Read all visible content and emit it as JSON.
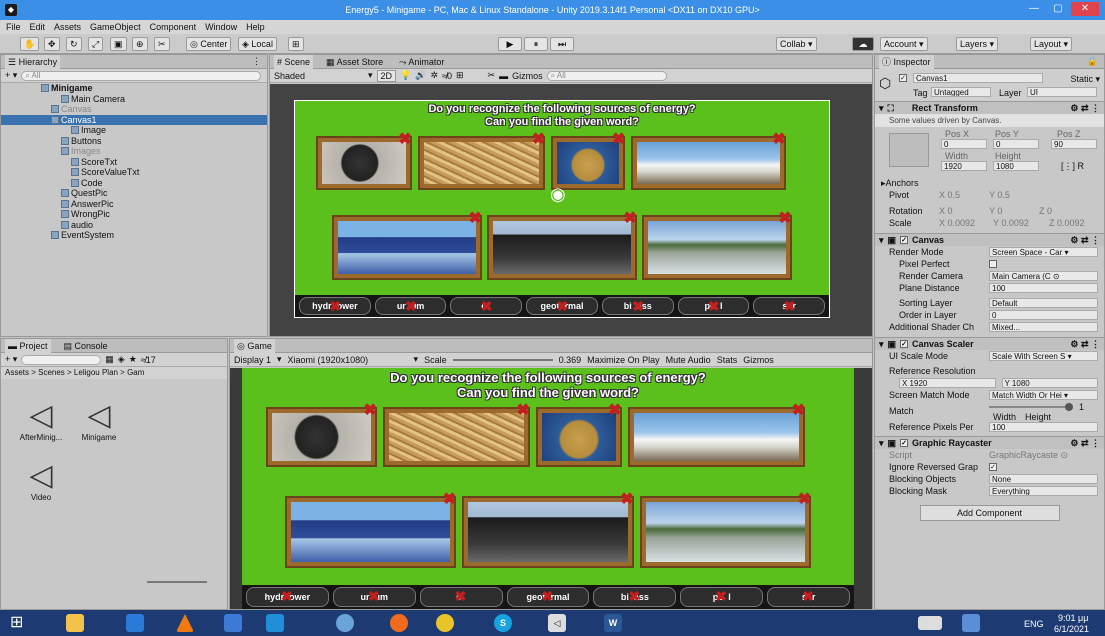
{
  "window": {
    "title": "Energy5 - Minigame - PC, Mac & Linux Standalone - Unity 2019.3.14f1 Personal <DX11 on DX10 GPU>",
    "app_icon": "unity-icon"
  },
  "menu": [
    "File",
    "Edit",
    "Assets",
    "GameObject",
    "Component",
    "Window",
    "Help"
  ],
  "toolbar": {
    "tools": [
      "hand-tool-icon",
      "move-tool-icon",
      "rotate-tool-icon",
      "scale-tool-icon",
      "rect-tool-icon",
      "transform-tool-icon",
      "custom-tool-icon"
    ],
    "center": "Center",
    "local": "Local",
    "play": "▶",
    "pause": "⏸",
    "step": "⏭",
    "collab": "Collab ▾",
    "account": "Account",
    "layers": "Layers",
    "layout": "Layout"
  },
  "hierarchy": {
    "tab": "Hierarchy",
    "search": "All",
    "items": [
      {
        "label": "Minigame",
        "indent": 0,
        "bold": true
      },
      {
        "label": "Main Camera",
        "indent": 2
      },
      {
        "label": "Canvas",
        "indent": 1,
        "dim": true
      },
      {
        "label": "Canvas1",
        "indent": 1,
        "selected": true
      },
      {
        "label": "Image",
        "indent": 3
      },
      {
        "label": "Buttons",
        "indent": 2
      },
      {
        "label": "Images",
        "indent": 2,
        "dim": true
      },
      {
        "label": "ScoreTxt",
        "indent": 3
      },
      {
        "label": "ScoreValueTxt",
        "indent": 3
      },
      {
        "label": "Code",
        "indent": 3
      },
      {
        "label": "QuestPic",
        "indent": 2
      },
      {
        "label": "AnswerPic",
        "indent": 2
      },
      {
        "label": "WrongPic",
        "indent": 2
      },
      {
        "label": "audio",
        "indent": 2
      },
      {
        "label": "EventSystem",
        "indent": 1
      }
    ]
  },
  "scene": {
    "tabs": [
      "Scene",
      "Asset Store",
      "Animator"
    ],
    "shading": "Shaded",
    "mode2d": "2D",
    "fx": "≉0",
    "gizmos": "Gizmos",
    "search": "All"
  },
  "game_canvas": {
    "question_line1": "Do you recognize the following sources of energy?",
    "question_line2": "Can you find the given word?",
    "top_pictures": [
      "rock",
      "straw",
      "urock",
      "geyser"
    ],
    "bottom_pictures": [
      "solar",
      "barrel",
      "dam"
    ],
    "words": [
      "hydr  ower",
      "ur  um",
      "c  ",
      "geot  rmal",
      "bi  ass",
      "pe  l",
      "s  r"
    ]
  },
  "project": {
    "tabs": [
      "Project",
      "Console"
    ],
    "breadcrumb": "Assets > Scenes > Leligou Plan > Gam",
    "count": "17",
    "search": "",
    "assets": [
      "AfterMinig...",
      "Minigame",
      "Video"
    ]
  },
  "game": {
    "tab": "Game",
    "display": "Display 1",
    "resolution": "Xiaomi (1920x1080)",
    "scale_label": "Scale",
    "scale_value": "0.369",
    "maximize": "Maximize On Play",
    "mute": "Mute Audio",
    "stats": "Stats",
    "gizmos": "Gizmos"
  },
  "inspector": {
    "tab": "Inspector",
    "name": "Canvas1",
    "static": "Static ▾",
    "tag_label": "Tag",
    "tag": "Untagged",
    "layer_label": "Layer",
    "layer": "UI",
    "rect_transform": {
      "title": "Rect Transform",
      "note": "Some values driven by Canvas.",
      "posx_label": "Pos X",
      "posy_label": "Pos Y",
      "posz_label": "Pos Z",
      "posx": "0",
      "posy": "0",
      "posz": "90",
      "width_label": "Width",
      "height_label": "Height",
      "width": "1920",
      "height": "1080",
      "anchors": "Anchors",
      "pivot_label": "Pivot",
      "pivot_x": "X 0.5",
      "pivot_y": "Y 0.5",
      "rotation_label": "Rotation",
      "rot_x": "X 0",
      "rot_y": "Y 0",
      "rot_z": "Z 0",
      "scale_label": "Scale",
      "scale_x": "X 0.0092",
      "scale_y": "Y 0.0092",
      "scale_z": "Z 0.0092"
    },
    "canvas": {
      "title": "Canvas",
      "render_mode_label": "Render Mode",
      "render_mode": "Screen Space - Car ▾",
      "pixel_perfect": "Pixel Perfect",
      "render_camera_label": "Render Camera",
      "render_camera": "Main Camera (C ⊙",
      "plane_distance_label": "Plane Distance",
      "plane_distance": "100",
      "sorting_layer_label": "Sorting Layer",
      "sorting_layer": "Default",
      "order_label": "Order in Layer",
      "order": "0",
      "shader_label": "Additional Shader Ch",
      "shader": "Mixed..."
    },
    "scaler": {
      "title": "Canvas Scaler",
      "ui_scale_label": "UI Scale Mode",
      "ui_scale": "Scale With Screen S ▾",
      "ref_res": "Reference Resolution",
      "ref_x": "X 1920",
      "ref_y": "Y 1080",
      "match_mode_label": "Screen Match Mode",
      "match_mode": "Match Width Or Hei ▾",
      "match_label": "Match",
      "match_value": "1",
      "width_lbl": "Width",
      "height_lbl": "Height",
      "ref_ppu_label": "Reference Pixels Per",
      "ref_ppu": "100"
    },
    "raycaster": {
      "title": "Graphic Raycaster",
      "script_label": "Script",
      "script": "GraphicRaycaste ⊙",
      "ignore_label": "Ignore Reversed Grap",
      "blocking_objects_label": "Blocking Objects",
      "blocking_objects": "None",
      "blocking_mask_label": "Blocking Mask",
      "blocking_mask": "Everything"
    },
    "add_component": "Add Component"
  },
  "taskbar": {
    "time": "9:01 μμ",
    "date": "6/1/2021",
    "lang": "ENG"
  }
}
